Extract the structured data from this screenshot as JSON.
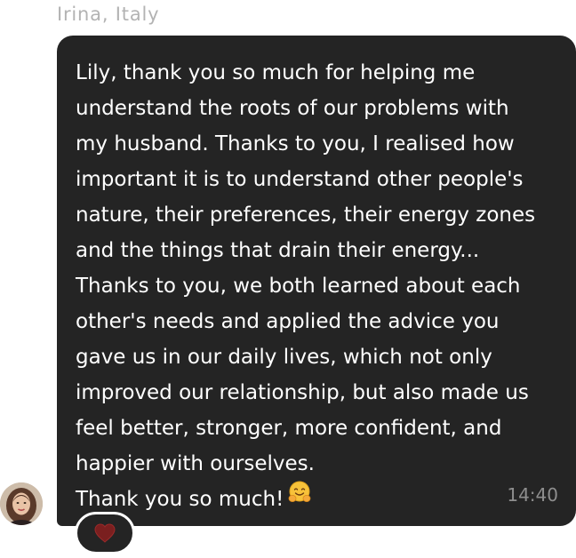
{
  "message": {
    "sender": "Irina, Italy",
    "text": "Lily, thank you so much for helping me\nunderstand the roots of our problems with\nmy husband. Thanks to you, I realised how\nimportant it is to understand other people's\nnature, their preferences, their energy zones\nand the things that drain their energy...\nThanks to you, we both learned about each\nother's needs and applied the advice you\ngave us in our daily lives, which not only\nimproved our relationship, but also made us\nfeel better, stronger, more confident, and\nhappier with ourselves.\nThank you so much!",
    "emoji": "hugging-face-emoji",
    "time": "14:40",
    "reaction": "heart-icon"
  },
  "colors": {
    "bubble": "#242424",
    "text": "#ffffff",
    "time": "#8e8e8e",
    "sender": "#b3b3b3",
    "heart": "#7a1f1f"
  }
}
